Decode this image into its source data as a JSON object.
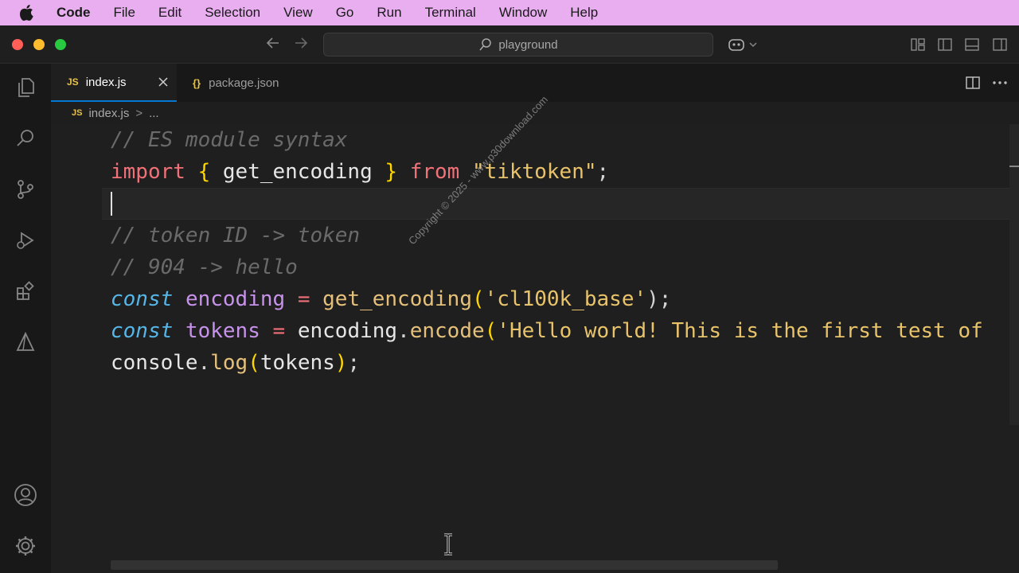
{
  "menubar": {
    "app_name": "Code",
    "items": [
      "File",
      "Edit",
      "Selection",
      "View",
      "Go",
      "Run",
      "Terminal",
      "Window",
      "Help"
    ]
  },
  "titlebar": {
    "search_text": "playground",
    "back_icon": "arrow-left-icon",
    "forward_icon": "arrow-right-icon"
  },
  "tabs": [
    {
      "label": "index.js",
      "badge": "JS",
      "active": true
    },
    {
      "label": "package.json",
      "badge": "{}",
      "active": false
    }
  ],
  "breadcrumb": {
    "badge": "JS",
    "file": "index.js",
    "separator": ">",
    "more": "..."
  },
  "editor": {
    "lines": [
      "// ES module syntax",
      "import { get_encoding } from \"tiktoken\";",
      "",
      "// token ID -> token",
      "// 904 -> hello",
      "const encoding = get_encoding('cl100k_base');",
      "const tokens = encoding.encode('Hello world! This is the first test of",
      "console.log(tokens);"
    ],
    "tokens": {
      "l1_comment": "// ES module syntax",
      "l2_import": "import",
      "l2_lbrace": "{",
      "l2_name": "get_encoding",
      "l2_rbrace": "}",
      "l2_from": "from",
      "l2_str": "\"tiktoken\"",
      "l2_semi": ";",
      "l4_comment": "// token ID -> token",
      "l5_comment": "// 904 -> hello",
      "l6_const": "const",
      "l6_var": "encoding",
      "l6_eq": "=",
      "l6_fn": "get_encoding",
      "l6_lp": "(",
      "l6_str": "'cl100k_base'",
      "l6_rp": ");",
      "l7_const": "const",
      "l7_var": "tokens",
      "l7_eq": "=",
      "l7_obj": "encoding",
      "l7_dot": ".",
      "l7_fn": "encode",
      "l7_lp": "(",
      "l7_str": "'Hello world! This is the first test of",
      "l8_obj": "console",
      "l8_dot": ".",
      "l8_fn": "log",
      "l8_lp": "(",
      "l8_arg": "tokens",
      "l8_rp": ")",
      "l8_semi": ";"
    }
  },
  "watermark": "Copyright © 2025 - www.p30download.com",
  "colors": {
    "menubar_bg": "#e8aef0",
    "accent": "#0078d4",
    "traffic_red": "#ff5f57",
    "traffic_yellow": "#febc2e",
    "traffic_green": "#28c840"
  }
}
